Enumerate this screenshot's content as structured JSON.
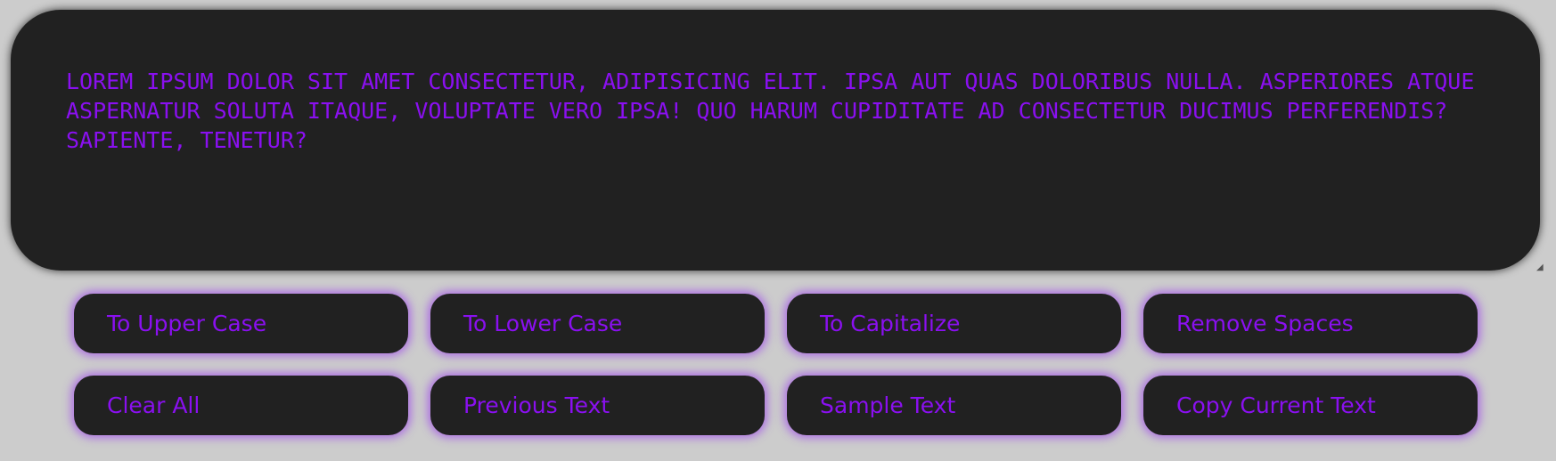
{
  "editor": {
    "text": "LOREM IPSUM DOLOR SIT AMET CONSECTETUR, ADIPISICING ELIT. IPSA AUT QUAS DOLORIBUS NULLA. ASPERIORES ATQUE ASPERNATUR SOLUTA ITAQUE, VOLUPTATE VERO IPSA! QUO HARUM CUPIDITATE AD CONSECTETUR DUCIMUS PERFERENDIS? SAPIENTE, TENETUR?"
  },
  "buttons": {
    "to_upper_case": "To Upper Case",
    "to_lower_case": "To Lower Case",
    "to_capitalize": "To Capitalize",
    "remove_spaces": "Remove Spaces",
    "clear_all": "Clear All",
    "previous_text": "Previous Text",
    "sample_text": "Sample Text",
    "copy_current_text": "Copy Current Text"
  },
  "colors": {
    "background": "#cccccc",
    "panel": "#212121",
    "accent": "#8a10f0",
    "glow": "#a65ce6"
  }
}
